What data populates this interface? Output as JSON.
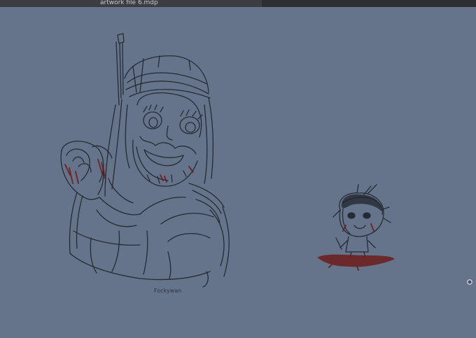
{
  "window": {
    "title": "artwork file 6.mdp"
  },
  "canvas": {
    "background_color": "#65748b",
    "line_color": "#1f242c",
    "blood_color": "#6e1c1c",
    "signature_text": "Fockywan"
  },
  "icons": {
    "cursor": "circle-cursor-icon"
  }
}
